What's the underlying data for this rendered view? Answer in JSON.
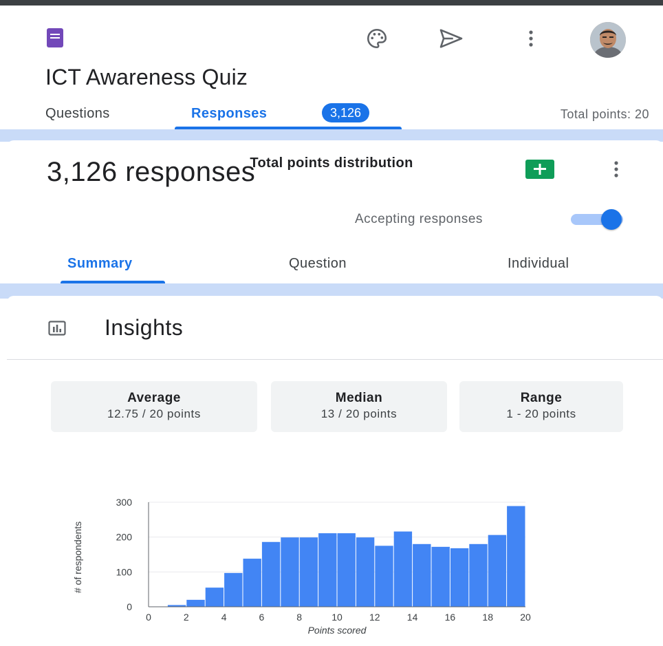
{
  "app": {
    "form_title": "ICT Awareness Quiz",
    "icons": [
      "forms-logo-icon",
      "palette-icon",
      "send-icon",
      "more-vert-icon",
      "avatar"
    ]
  },
  "tabs": {
    "questions": "Questions",
    "responses": "Responses",
    "responses_badge": "3,126",
    "total_points": "Total points: 20"
  },
  "responses": {
    "title": "3,126 responses",
    "accepting_label": "Accepting responses",
    "accepting_on": true
  },
  "sub_tabs": {
    "summary": "Summary",
    "question": "Question",
    "individual": "Individual",
    "active": "Summary"
  },
  "insights": {
    "title": "Insights",
    "stats": {
      "average_label": "Average",
      "average_value": "12.75 / 20 points",
      "median_label": "Median",
      "median_value": "13 / 20 points",
      "range_label": "Range",
      "range_value": "1 - 20 points"
    }
  },
  "colors": {
    "accent": "#1a73e8",
    "bar": "#4285f4",
    "band": "#c9dbf8",
    "forms_purple": "#7248b9",
    "sheets_green": "#0f9d58"
  },
  "chart_data": {
    "type": "bar",
    "title": "Total points distribution",
    "xlabel": "Points scored",
    "ylabel": "# of respondents",
    "x": [
      1,
      2,
      3,
      4,
      5,
      6,
      7,
      8,
      9,
      10,
      11,
      12,
      13,
      14,
      15,
      16,
      17,
      18,
      19,
      20
    ],
    "values": [
      1,
      5,
      20,
      55,
      97,
      138,
      186,
      199,
      199,
      211,
      211,
      199,
      175,
      216,
      180,
      172,
      168,
      180,
      206,
      289
    ],
    "xlim": [
      0,
      20
    ],
    "ylim": [
      0,
      300
    ],
    "x_ticks": [
      0,
      2,
      4,
      6,
      8,
      10,
      12,
      14,
      16,
      18,
      20
    ],
    "y_ticks": [
      0,
      100,
      200,
      300
    ],
    "grid": true,
    "legend": "none"
  }
}
